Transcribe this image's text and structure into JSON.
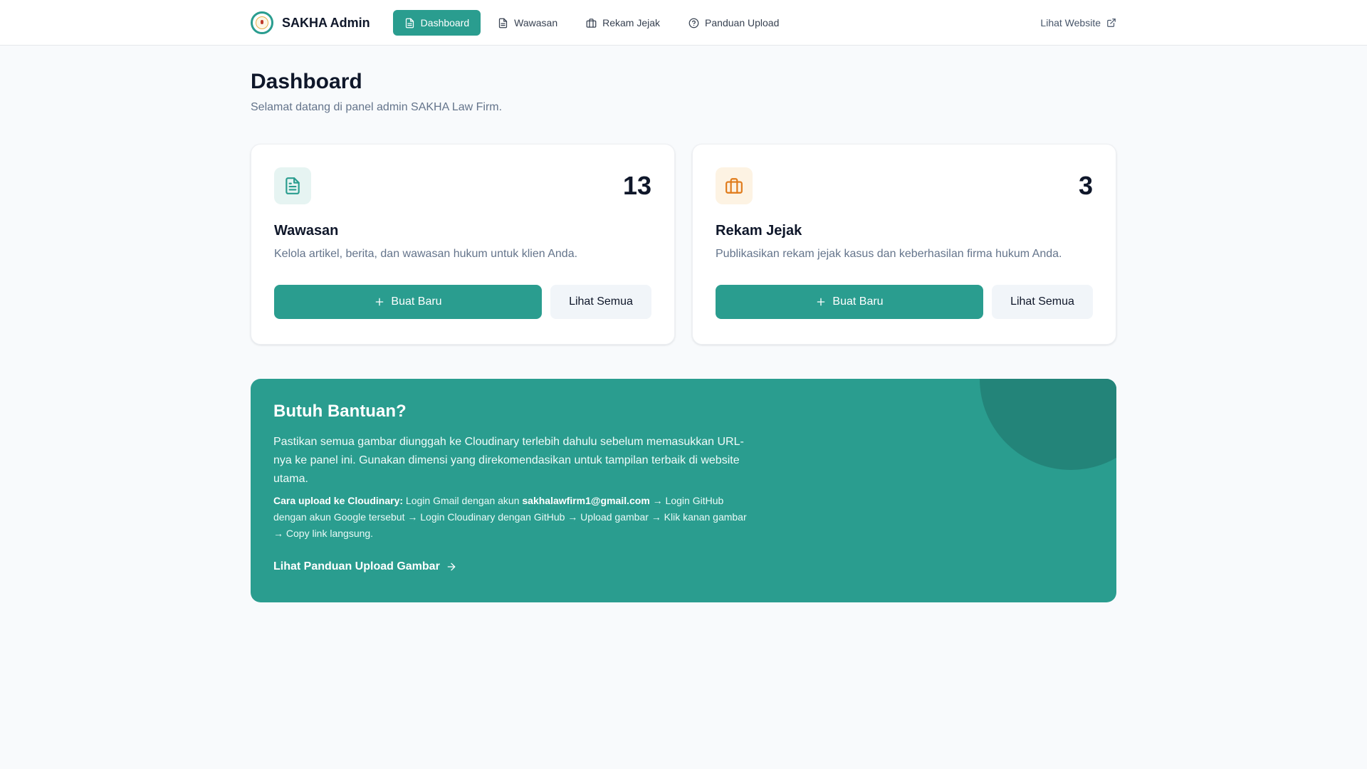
{
  "nav": {
    "brand": "SAKHA Admin",
    "links": [
      {
        "label": "Dashboard",
        "icon": "document-icon",
        "active": true
      },
      {
        "label": "Wawasan",
        "icon": "document-icon",
        "active": false
      },
      {
        "label": "Rekam Jejak",
        "icon": "briefcase-icon",
        "active": false
      },
      {
        "label": "Panduan Upload",
        "icon": "help-circle-icon",
        "active": false
      }
    ],
    "external": "Lihat Website"
  },
  "page": {
    "title": "Dashboard",
    "subtitle": "Selamat datang di panel admin SAKHA Law Firm."
  },
  "cards": [
    {
      "icon": "document-icon",
      "accent": "#2a9d8f",
      "count": "13",
      "title": "Wawasan",
      "description": "Kelola artikel, berita, dan wawasan hukum untuk klien Anda.",
      "primary_label": "Buat Baru",
      "secondary_label": "Lihat Semua"
    },
    {
      "icon": "briefcase-icon",
      "accent": "#e07b1a",
      "count": "3",
      "title": "Rekam Jejak",
      "description": "Publikasikan rekam jejak kasus dan keberhasilan firma hukum Anda.",
      "primary_label": "Buat Baru",
      "secondary_label": "Lihat Semua"
    }
  ],
  "help": {
    "title": "Butuh Bantuan?",
    "text": "Pastikan semua gambar diunggah ke Cloudinary terlebih dahulu sebelum memasukkan URL-nya ke panel ini. Gunakan dimensi yang direkomendasikan untuk tampilan terbaik di website utama.",
    "steps_label": "Cara upload ke Cloudinary:",
    "steps_pre": " Login Gmail dengan akun ",
    "steps_email": "sakhalawfirm1@gmail.com",
    "steps_post": " → Login GitHub dengan akun Google tersebut → Login Cloudinary dengan GitHub → Upload gambar → Klik kanan gambar → Copy link langsung.",
    "link": "Lihat Panduan Upload Gambar"
  },
  "colors": {
    "primary": "#2a9d8f",
    "orange": "#e07b1a",
    "text": "#0f172a",
    "muted": "#64748b"
  }
}
